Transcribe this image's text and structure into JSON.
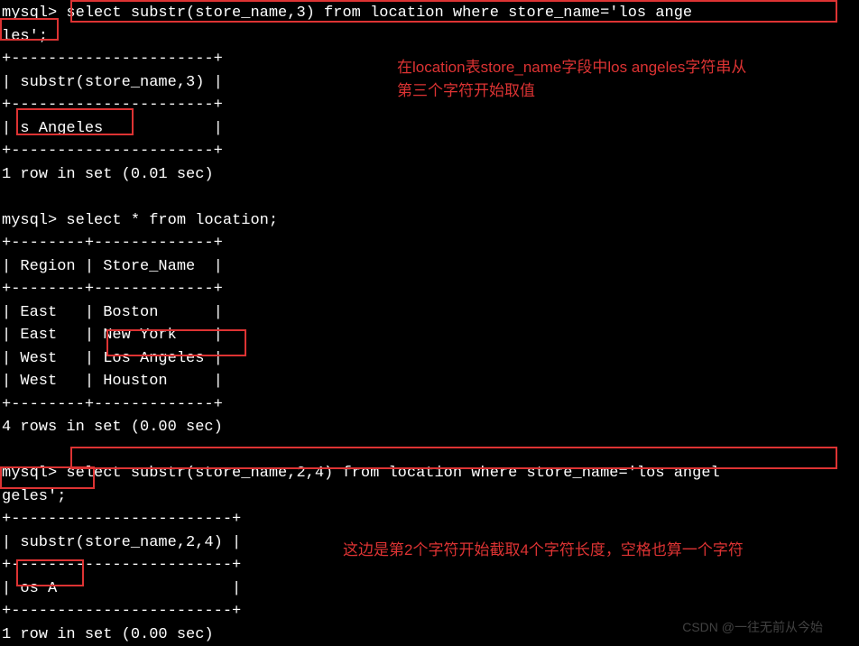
{
  "prompt": "mysql>",
  "queries": {
    "q1_line1": "mysql> select substr(store_name,3) from location where store_name='los ange",
    "q1_line2": "les';",
    "q2": "mysql> select * from location;",
    "q3_line1": "mysql> select substr(store_name,2,4) from location where store_name='los angel",
    "q3_line2": "geles';"
  },
  "table1": {
    "sep": "+----------------------+",
    "header": "| substr(store_name,3) |",
    "row": "| s Angeles            |",
    "footer": "1 row in set (0.01 sec)"
  },
  "table2": {
    "sep": "+--------+-------------+",
    "header": "| Region | Store_Name  |",
    "rows": [
      "| East   | Boston      |",
      "| East   | New York    |",
      "| West   | Los Angeles |",
      "| West   | Houston     |"
    ],
    "footer": "4 rows in set (0.00 sec)"
  },
  "table3": {
    "sep": "+------------------------+",
    "header": "| substr(store_name,2,4) |",
    "row": "| os A                   |",
    "footer": "1 row in set (0.00 sec)"
  },
  "annotations": {
    "a1": "在location表store_name字段中los angeles字符串从\n第三个字符开始取值",
    "a2": "这边是第2个字符开始截取4个字符长度，空格也算一个字符"
  },
  "watermark": "CSDN @一往无前从今始"
}
